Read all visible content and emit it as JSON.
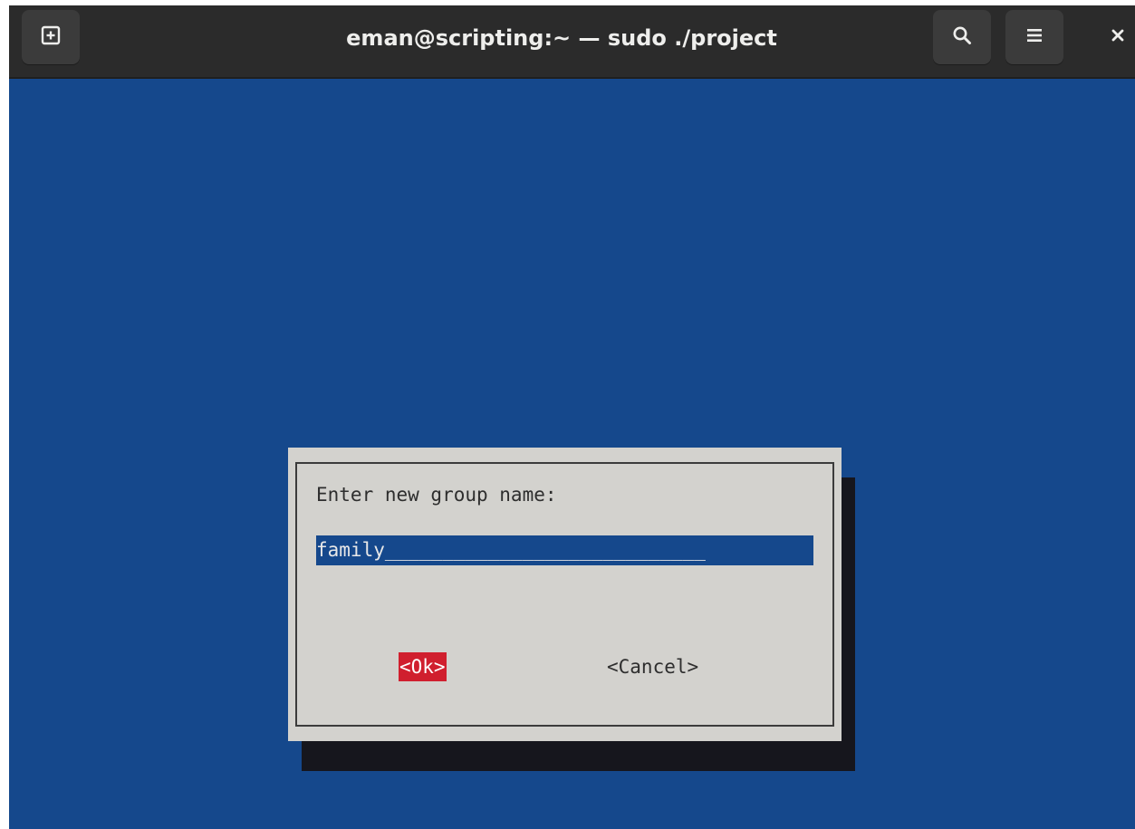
{
  "window": {
    "title": "eman@scripting:~ — sudo ./project"
  },
  "toolbar": {
    "new_tab_icon": "new-tab-icon",
    "search_icon": "search-icon",
    "menu_icon": "hamburger-menu-icon",
    "close_glyph": "×"
  },
  "dialog": {
    "prompt": "Enter new group name:",
    "input_value": "family",
    "input_fill": "____________________________",
    "ok_label": "<Ok>",
    "cancel_label": "<Cancel>"
  },
  "colors": {
    "terminal_background": "#15488c",
    "dialog_background": "#d3d2ce",
    "selected_button": "#d01f2e",
    "titlebar": "#2b2b2b"
  }
}
